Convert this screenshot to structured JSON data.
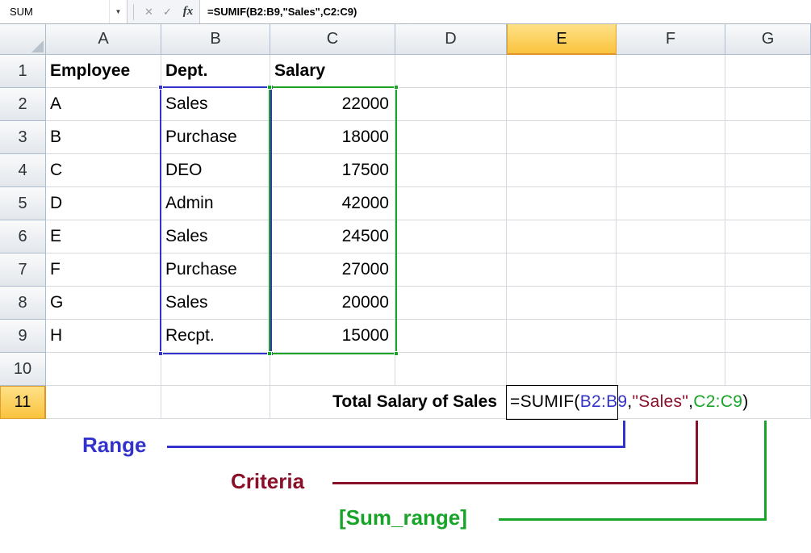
{
  "formula_bar": {
    "name_box_value": "SUM",
    "formula": "=SUMIF(B2:B9,\"Sales\",C2:C9)",
    "icons": {
      "dropdown": "▼",
      "cancel": "✕",
      "enter": "✓",
      "insert_function": "fx"
    }
  },
  "grid": {
    "column_headers": [
      "A",
      "B",
      "C",
      "D",
      "E",
      "F",
      "G"
    ],
    "row_headers": [
      "1",
      "2",
      "3",
      "4",
      "5",
      "6",
      "7",
      "8",
      "9",
      "10",
      "11"
    ],
    "selected_column": "E",
    "selected_row": "11",
    "cells": {
      "A1": "Employee",
      "B1": "Dept.",
      "C1": "Salary",
      "A2": "A",
      "B2": "Sales",
      "C2": "22000",
      "A3": "B",
      "B3": "Purchase",
      "C3": "18000",
      "A4": "C",
      "B4": "DEO",
      "C4": "17500",
      "A5": "D",
      "B5": "Admin",
      "C5": "42000",
      "A6": "E",
      "B6": "Sales",
      "C6": "24500",
      "A7": "F",
      "B7": "Purchase",
      "C7": "27000",
      "A8": "G",
      "B8": "Sales",
      "C8": "20000",
      "A9": "H",
      "B9": "Recpt.",
      "C9": "15000",
      "C11": "Total Salary of Sales"
    },
    "active_cell_formula": {
      "prefix": "=SUMIF(",
      "range_arg": "B2:B9",
      "separator1": ",",
      "criteria_arg": "\"Sales\"",
      "separator2": ",",
      "sum_range_arg": "C2:C9",
      "suffix": ")"
    },
    "selection": {
      "range": "B2:B9",
      "sum_range": "C2:C9",
      "range_border_color": "#3333CC",
      "sum_range_border_color": "#18A428"
    }
  },
  "annotations": {
    "range": {
      "label": "Range",
      "color": "#3333CC"
    },
    "criteria": {
      "label": "Criteria",
      "color": "#8B1029"
    },
    "sum_range": {
      "label": "[Sum_range]",
      "color": "#18A428"
    }
  },
  "colors": {
    "selected_header_bg": "#FAC33E",
    "formula_range_text": "#3333CC",
    "formula_criteria_text": "#8B1029",
    "formula_sum_range_text": "#18A428"
  }
}
